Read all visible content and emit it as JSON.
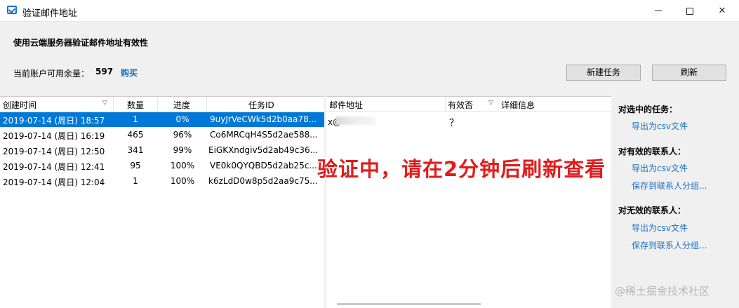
{
  "window": {
    "title": "验证邮件地址"
  },
  "header": {
    "heading": "使用云端服务器验证邮件地址有效性",
    "quota_label": "当前账户可用余量：",
    "quota_value": "597",
    "buy_label": "购买"
  },
  "toolbar": {
    "new_task_label": "新建任务",
    "refresh_label": "刷新"
  },
  "tasks": {
    "columns": [
      "创建时间",
      "数量",
      "进度",
      "任务ID"
    ],
    "rows": [
      {
        "created": "2019-07-14 (周日) 18:57",
        "count": "1",
        "progress": "0%",
        "id": "9uyJrVeCWk5d2b0aa78..."
      },
      {
        "created": "2019-07-14 (周日) 16:19",
        "count": "465",
        "progress": "96%",
        "id": "Co6MRCqH4S5d2ae588..."
      },
      {
        "created": "2019-07-14 (周日) 12:50",
        "count": "341",
        "progress": "99%",
        "id": "EiGKXndgiv5d2ab49c36..."
      },
      {
        "created": "2019-07-14 (周日) 12:41",
        "count": "95",
        "progress": "100%",
        "id": "VE0k0QYQBD5d2ab25c..."
      },
      {
        "created": "2019-07-14 (周日) 12:04",
        "count": "1",
        "progress": "100%",
        "id": "k6zLdD0w8p5d2aa9c75..."
      }
    ]
  },
  "emails": {
    "columns": [
      "邮件地址",
      "有效否",
      "详细信息"
    ],
    "rows": [
      {
        "address_prefix": "x@",
        "valid": "？"
      }
    ]
  },
  "actions": {
    "selected_title": "对选中的任务：",
    "selected_export": "导出为csv文件",
    "valid_title": "对有效的联系人：",
    "valid_export": "导出为csv文件",
    "valid_save": "保存到联系人分组...",
    "invalid_title": "对无效的联系人：",
    "invalid_export": "导出为csv文件",
    "invalid_save": "保存到联系人分组..."
  },
  "overlay_text": "验证中，请在2分钟后刷新查看",
  "watermark": "@稀土掘金技术社区",
  "colors": {
    "accent": "#0078d7",
    "link": "#1a6fc4",
    "overlay": "#e21b1b"
  }
}
